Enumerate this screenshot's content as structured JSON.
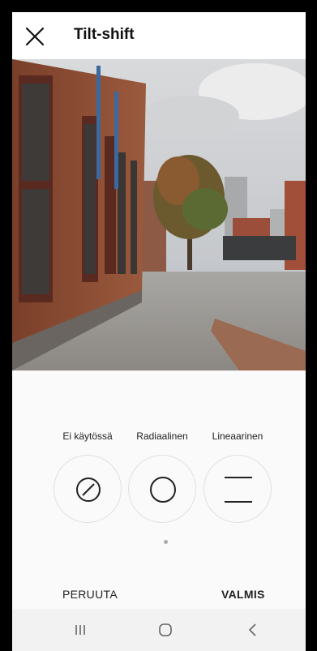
{
  "header": {
    "title": "Tilt-shift"
  },
  "tools": [
    {
      "label": "Ei käytössä",
      "icon": "no-blur-icon"
    },
    {
      "label": "Radiaalinen",
      "icon": "radial-icon"
    },
    {
      "label": "Lineaarinen",
      "icon": "linear-icon"
    }
  ],
  "footer": {
    "cancel_label": "PERUUTA",
    "done_label": "VALMIS"
  },
  "navbar": {
    "icons": [
      "recent-apps-icon",
      "home-icon",
      "back-icon"
    ]
  }
}
